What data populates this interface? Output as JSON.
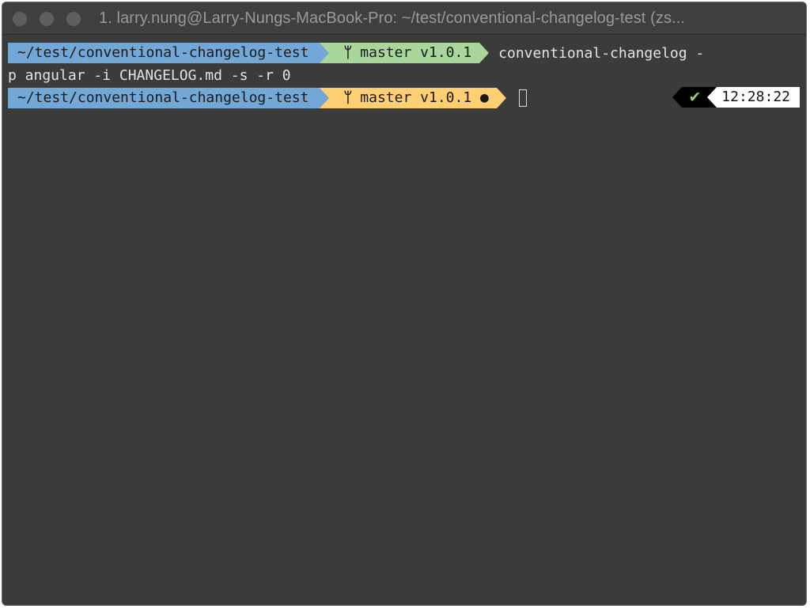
{
  "window": {
    "title": "1. larry.nung@Larry-Nungs-MacBook-Pro: ~/test/conventional-changelog-test (zs..."
  },
  "prompt1": {
    "path": "~/test/conventional-changelog-test",
    "branch_icon": "ᛘ",
    "git": "master v1.0.1",
    "command_part1": "conventional-changelog -",
    "command_part2": "p angular -i CHANGELOG.md -s -r 0"
  },
  "prompt2": {
    "path": "~/test/conventional-changelog-test",
    "branch_icon": "ᛘ",
    "git": "master v1.0.1 ●"
  },
  "rprompt": {
    "status_icon": "✔",
    "time": "12:28:22"
  },
  "colors": {
    "path_bg": "#72a7d6",
    "git_clean_bg": "#a9d79b",
    "git_dirty_bg": "#ffcf73",
    "background": "#3b3b39"
  },
  "icons": [
    "git-branch-icon",
    "checkmark-icon"
  ]
}
